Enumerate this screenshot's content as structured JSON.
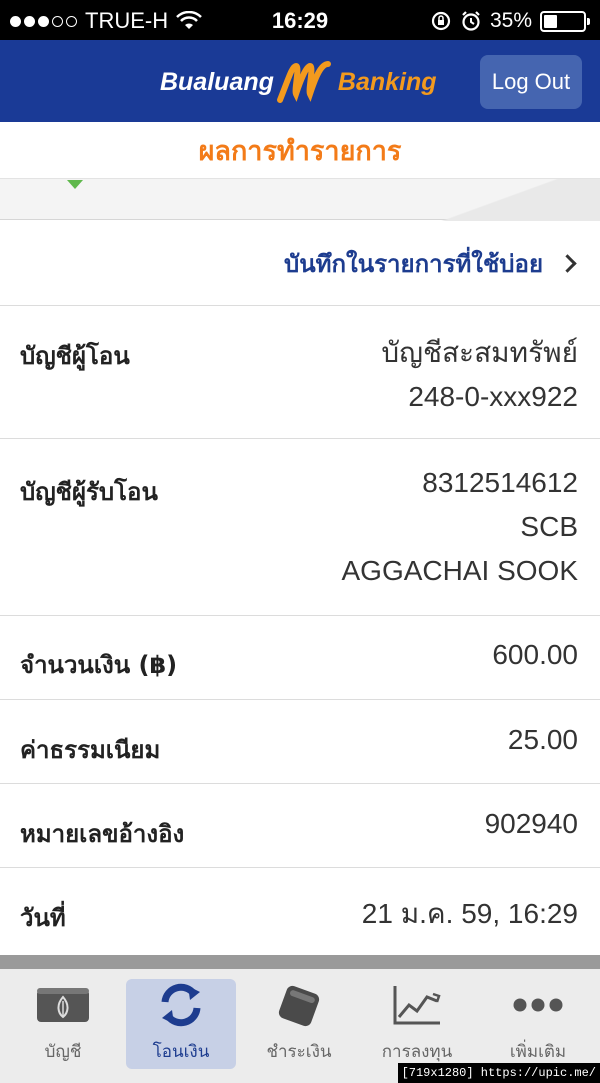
{
  "status_bar": {
    "carrier": "TRUE-H",
    "time": "16:29",
    "battery": "35%",
    "battery_level": 0.35
  },
  "header": {
    "logo_part1": "Bualuang",
    "logo_part2": "Banking",
    "logout_label": "Log Out"
  },
  "page_title": "ผลการทำรายการ",
  "favorite_link": "บันทึกในรายการที่ใช้บ่อย",
  "details": [
    {
      "label": "บัญชีผู้โอน",
      "values": [
        "บัญชีสะสมทรัพย์",
        "248-0-xxx922"
      ]
    },
    {
      "label": "บัญชีผู้รับโอน",
      "values": [
        "8312514612",
        "SCB",
        "AGGACHAI SOOK"
      ]
    },
    {
      "label": "จำนวนเงิน (฿)",
      "values": [
        "600.00"
      ]
    },
    {
      "label": "ค่าธรรมเนียม",
      "values": [
        "25.00"
      ]
    },
    {
      "label": "หมายเลขอ้างอิง",
      "values": [
        "902940"
      ]
    },
    {
      "label": "วันที่",
      "values": [
        "21 ม.ค. 59, 16:29"
      ]
    }
  ],
  "tabs": [
    {
      "label": "บัญชี",
      "icon": "wallet-leaf-icon",
      "active": false
    },
    {
      "label": "โอนเงิน",
      "icon": "transfer-arrows-icon",
      "active": true
    },
    {
      "label": "ชำระเงิน",
      "icon": "wallet-icon",
      "active": false
    },
    {
      "label": "การลงทุน",
      "icon": "chart-icon",
      "active": false
    },
    {
      "label": "เพิ่มเติม",
      "icon": "more-dots-icon",
      "active": false
    }
  ],
  "watermark": "[719x1280] https://upic.me/",
  "colors": {
    "header_blue": "#1a3a96",
    "accent_orange": "#f37b18",
    "link_blue": "#1d3c8f"
  }
}
